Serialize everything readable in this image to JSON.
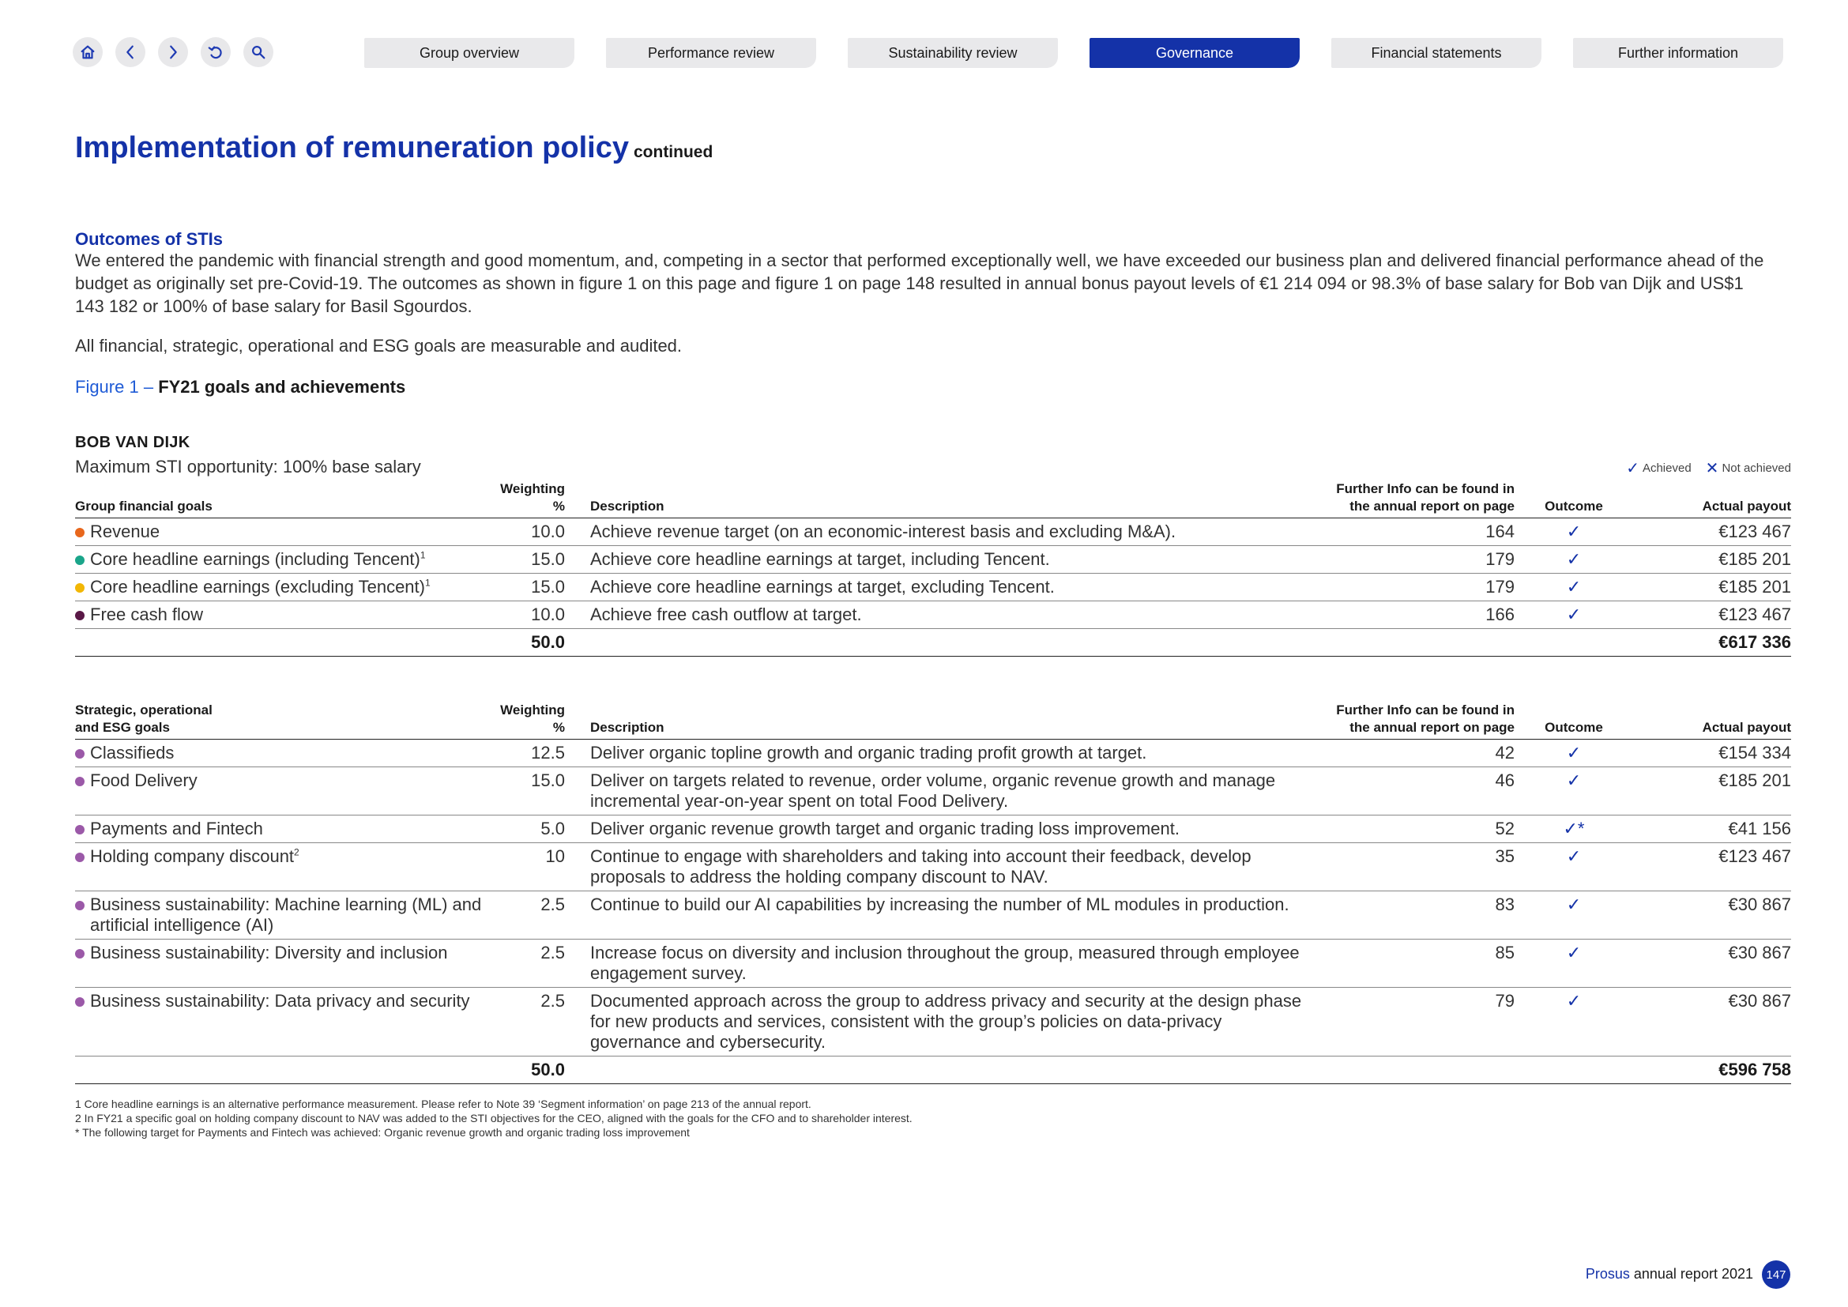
{
  "nav": {
    "tabs": [
      {
        "label": "Group overview"
      },
      {
        "label": "Performance review"
      },
      {
        "label": "Sustainability review"
      },
      {
        "label": "Governance"
      },
      {
        "label": "Financial statements"
      },
      {
        "label": "Further information"
      }
    ],
    "active_tab": "Governance",
    "icons": [
      "home-icon",
      "back-icon",
      "forward-icon",
      "undo-icon",
      "search-icon"
    ]
  },
  "page": {
    "title": "Implementation of remuneration policy",
    "title_suffix": "continued",
    "section_heading": "Outcomes of STIs",
    "intro": "We entered the pandemic with financial strength and good momentum, and, competing in a sector that performed exceptionally well, we have exceeded our business plan and delivered financial performance ahead of the budget as originally set pre-Covid-19. The outcomes as shown in figure 1 on this page and figure 1 on page 148 resulted in annual bonus payout levels of €1 214 094 or 98.3% of base salary for Bob van Dijk and US$1 143 182 or 100% of base salary for Basil Sgourdos.",
    "intro2": "All financial, strategic, operational and ESG goals are measurable and audited.",
    "figure_label": "Figure 1 –",
    "figure_title": "FY21 goals and achievements",
    "person": "BOB VAN DIJK",
    "max_sti": "Maximum STI opportunity: 100% base salary",
    "legend_achieved": "Achieved",
    "legend_not_achieved": "Not achieved"
  },
  "colors": {
    "accent": "#1432a8",
    "revenue": "#e8671c",
    "core_incl": "#1aa58a",
    "core_excl": "#f2b705",
    "fcf": "#5a1846",
    "strategic": "#9b59a8"
  },
  "table1": {
    "headers": {
      "goal": "Group financial goals",
      "weighting": "Weighting %",
      "description": "Description",
      "info": "Further Info can be found in the annual report on page",
      "outcome": "Outcome",
      "payout": "Actual payout"
    },
    "rows": [
      {
        "goal": "Revenue",
        "sup": "",
        "weighting": "10.0",
        "description": "Achieve revenue target (on an economic-interest basis and excluding M&A).",
        "page": "164",
        "outcome": "✓",
        "payout": "€123 467"
      },
      {
        "goal": "Core headline earnings (including Tencent)",
        "sup": "1",
        "weighting": "15.0",
        "description": "Achieve core headline earnings at target, including Tencent.",
        "page": "179",
        "outcome": "✓",
        "payout": "€185 201"
      },
      {
        "goal": "Core headline earnings (excluding Tencent)",
        "sup": "1",
        "weighting": "15.0",
        "description": "Achieve core headline earnings at target, excluding Tencent.",
        "page": "179",
        "outcome": "✓",
        "payout": "€185 201"
      },
      {
        "goal": "Free cash flow",
        "sup": "",
        "weighting": "10.0",
        "description": "Achieve free cash outflow at target.",
        "page": "166",
        "outcome": "✓",
        "payout": "€123 467"
      }
    ],
    "total_weighting": "50.0",
    "total_payout": "€617 336"
  },
  "table2": {
    "headers": {
      "goal": "Strategic, operational and ESG goals",
      "weighting": "Weighting %",
      "description": "Description",
      "info": "Further Info can be found in the annual report on page",
      "outcome": "Outcome",
      "payout": "Actual payout"
    },
    "rows": [
      {
        "goal": "Classifieds",
        "sup": "",
        "weighting": "12.5",
        "description": "Deliver organic topline growth and organic trading profit growth at target.",
        "page": "42",
        "outcome": "✓",
        "payout": "€154 334"
      },
      {
        "goal": "Food Delivery",
        "sup": "",
        "weighting": "15.0",
        "description": "Deliver on targets related to revenue, order volume, organic revenue growth and manage incremental year-on-year spent on total Food Delivery.",
        "page": "46",
        "outcome": "✓",
        "payout": "€185 201"
      },
      {
        "goal": "Payments and Fintech",
        "sup": "",
        "weighting": "5.0",
        "description": "Deliver organic revenue growth target and organic trading loss improvement.",
        "page": "52",
        "outcome": "✓*",
        "payout": "€41 156"
      },
      {
        "goal": "Holding company discount",
        "sup": "2",
        "weighting": "10",
        "description": "Continue to engage with shareholders and taking into account their feedback, develop proposals to address the holding company discount to NAV.",
        "page": "35",
        "outcome": "✓",
        "payout": "€123 467"
      },
      {
        "goal": "Business sustainability: Machine learning (ML) and artificial intelligence (AI)",
        "sup": "",
        "weighting": "2.5",
        "description": "Continue to build our AI capabilities by increasing the number of ML modules in production.",
        "page": "83",
        "outcome": "✓",
        "payout": "€30 867"
      },
      {
        "goal": "Business sustainability: Diversity and inclusion",
        "sup": "",
        "weighting": "2.5",
        "description": "Increase focus on diversity and inclusion throughout the group, measured through employee engagement survey.",
        "page": "85",
        "outcome": "✓",
        "payout": "€30 867"
      },
      {
        "goal": "Business sustainability: Data privacy and security",
        "sup": "",
        "weighting": "2.5",
        "description": "Documented approach across the group to address privacy and security at the design phase for new products and services, consistent with the group’s policies on data-privacy governance and cybersecurity.",
        "page": "79",
        "outcome": "✓",
        "payout": "€30 867"
      }
    ],
    "total_weighting": "50.0",
    "total_payout": "€596 758"
  },
  "footnotes": [
    "1   Core headline earnings is an alternative performance measurement. Please refer to Note 39 ‘Segment information’ on page 213 of the annual report.",
    "2   In FY21 a specific goal on holding company discount to NAV was added to the STI objectives for the CEO, aligned with the goals for the CFO and to shareholder interest.",
    "* The following target for Payments and Fintech was achieved: Organic revenue growth and organic trading loss improvement"
  ],
  "footer": {
    "brand": "Prosus",
    "text": "annual report 2021",
    "page": "147"
  }
}
